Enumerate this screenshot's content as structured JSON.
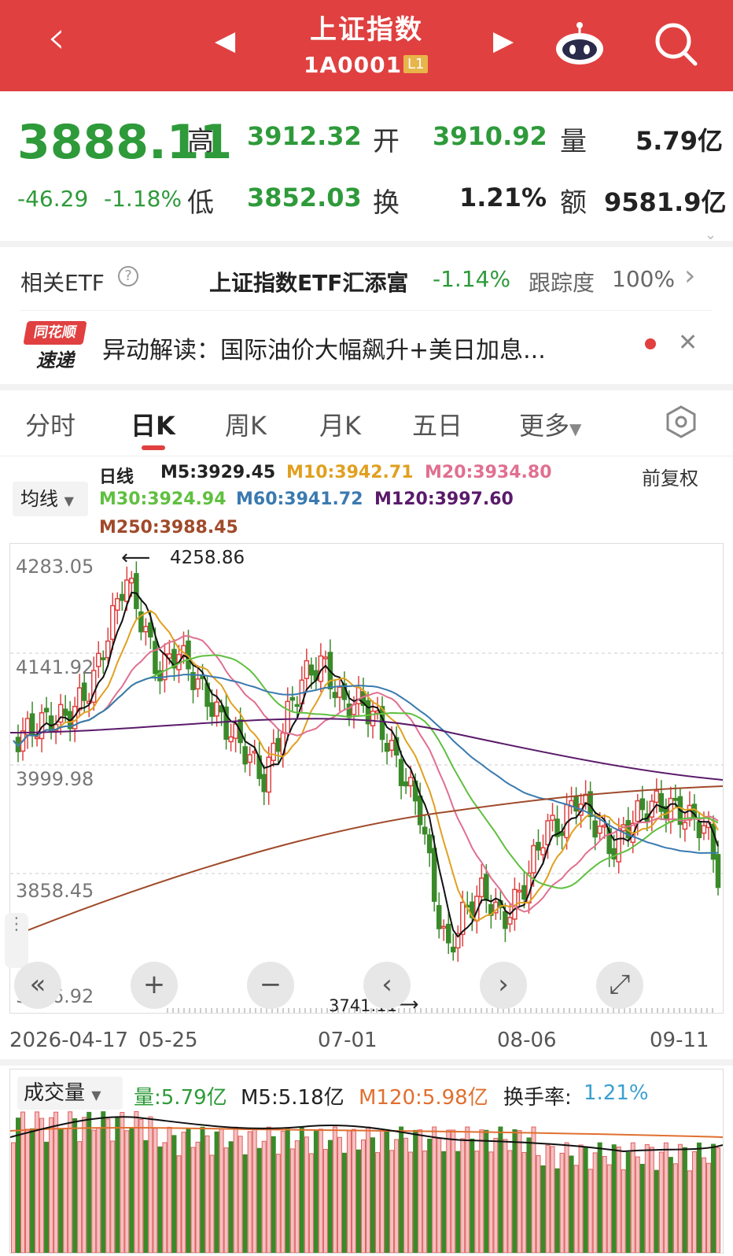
{
  "header": {
    "back": "‹",
    "prev": "◀",
    "next": "▶",
    "title": "上证指数",
    "code": "1A0001",
    "level": "L1",
    "bot_icon": "robot-icon",
    "search_icon": "search-icon"
  },
  "quote": {
    "price": "3888.11",
    "change": "-46.29",
    "change_pct": "-1.18%",
    "high_label": "高",
    "high": "3912.32",
    "open_label": "开",
    "open": "3910.92",
    "vol_label": "量",
    "vol": "5.79亿",
    "low_label": "低",
    "low": "3852.03",
    "turn_label": "换",
    "turn": "1.21%",
    "amt_label": "额",
    "amt": "9581.9亿"
  },
  "etf": {
    "label": "相关ETF",
    "help": "?",
    "name": "上证指数ETF汇添富",
    "pct": "-1.14%",
    "track_label": "跟踪度",
    "track": "100%",
    "arrow": "›"
  },
  "news": {
    "logo_top": "同花顺",
    "logo_bottom": "速递",
    "text": "异动解读：国际油价大幅飙升+美日加息...",
    "close": "✕"
  },
  "tabs": [
    "分时",
    "日K",
    "周K",
    "月K",
    "五日",
    "更多"
  ],
  "ma_bar": {
    "select": "均线",
    "daily": "日线",
    "m5": "M5:3929.45",
    "m10": "M10:3942.71",
    "m20": "M20:3934.80",
    "m30": "M30:3924.94",
    "m60": "M60:3941.72",
    "m120": "M120:3997.60",
    "m250": "M250:3988.45",
    "fq": "前复权"
  },
  "chart_labels": {
    "y": [
      "4283.05",
      "4141.92",
      "3999.98",
      "3858.45",
      "3716.92"
    ],
    "high_mark": "4258.86",
    "low_mark": "3741.11",
    "x": [
      "2026-04-17",
      "05-25",
      "07-01",
      "08-06",
      "09-11"
    ]
  },
  "vol_bar": {
    "select": "成交量",
    "vol": "量:5.79亿",
    "m5": "M5:5.18亿",
    "m120": "M120:5.98亿",
    "turn_label": "换手率:",
    "turn": "1.21%"
  },
  "colors": {
    "red": "#e04040",
    "green": "#2e9a3a",
    "m10": "#e0a020",
    "m20": "#e07090",
    "m30": "#60c040",
    "m60": "#3a7ab0",
    "m120": "#5a1a6a",
    "m250": "#a04a2a"
  },
  "controls": {
    "zoom_in": "+",
    "zoom_out": "−",
    "left": "‹",
    "right": "›",
    "fit": "⤢",
    "collapse": "«"
  }
}
